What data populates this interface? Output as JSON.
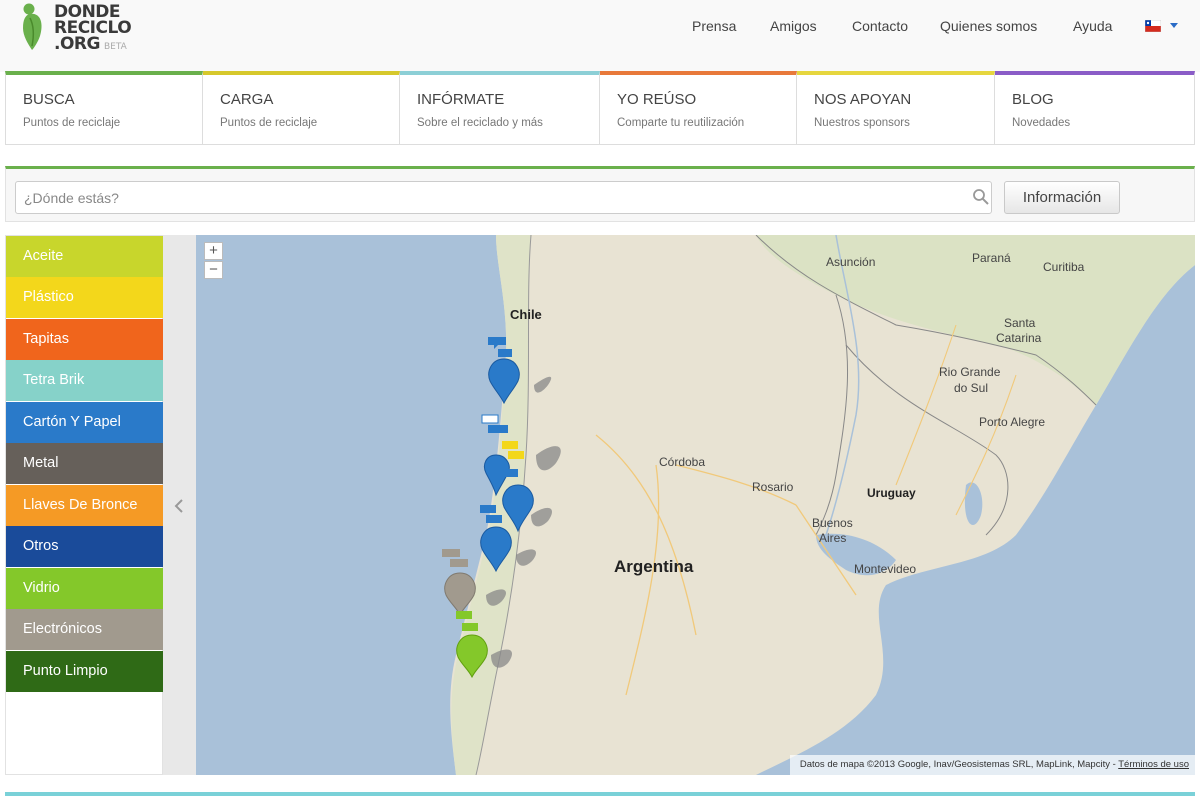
{
  "brand": {
    "logo_line1": "DONDE",
    "logo_line2": "RECICLO",
    "logo_line3": ".ORG",
    "beta": "BETA"
  },
  "topnav": [
    "Prensa",
    "Amigos",
    "Contacto",
    "Quienes somos",
    "Ayuda"
  ],
  "tabs": [
    {
      "title": "BUSCA",
      "subtitle": "Puntos de reciclaje",
      "color": "#6ab04c"
    },
    {
      "title": "CARGA",
      "subtitle": "Puntos de reciclaje",
      "color": "#d6c82c"
    },
    {
      "title": "INFÓRMATE",
      "subtitle": "Sobre el reciclado y más",
      "color": "#8ccfd6"
    },
    {
      "title": "YO REÚSO",
      "subtitle": "Comparte tu reutilización",
      "color": "#e8793a"
    },
    {
      "title": "NOS APOYAN",
      "subtitle": "Nuestros sponsors",
      "color": "#e6d63e"
    },
    {
      "title": "BLOG",
      "subtitle": "Novedades",
      "color": "#8a5cc7"
    }
  ],
  "search": {
    "placeholder": "¿Dónde estás?",
    "value": "",
    "info_button": "Información"
  },
  "categories": [
    {
      "label": "Aceite",
      "color": "#c8d62c"
    },
    {
      "label": "Plástico",
      "color": "#f3d71b"
    },
    {
      "label": "Tapitas",
      "color": "#f0651c"
    },
    {
      "label": "Tetra Brik",
      "color": "#86d2c9"
    },
    {
      "label": "Cartón Y Papel",
      "color": "#2a7ac9"
    },
    {
      "label": "Metal",
      "color": "#66605a"
    },
    {
      "label": "Llaves De Bronce",
      "color": "#f59a25"
    },
    {
      "label": "Otros",
      "color": "#1a4b9a"
    },
    {
      "label": "Vidrio",
      "color": "#84c82a"
    },
    {
      "label": "Electrónicos",
      "color": "#a19a8e"
    },
    {
      "label": "Punto Limpio",
      "color": "#2f6a16"
    }
  ],
  "map": {
    "zoom_in": "+",
    "zoom_out": "−",
    "labels": {
      "asuncion": "Asunción",
      "parana": "Paraná",
      "curitiba": "Curitiba",
      "chile": "Chile",
      "santa_catarina_1": "Santa",
      "santa_catarina_2": "Catarina",
      "rio_grande_1": "Rio Grande",
      "rio_grande_2": "do Sul",
      "porto_alegre": "Porto Alegre",
      "cordoba": "Córdoba",
      "rosario": "Rosario",
      "uruguay": "Uruguay",
      "buenos_aires_1": "Buenos",
      "buenos_aires_2": "Aires",
      "montevideo": "Montevideo",
      "argentina": "Argentina"
    },
    "attribution": "Datos de mapa ©2013 Google, Inav/Geosistemas SRL, MapLink, Mapcity - ",
    "terms": "Términos de uso"
  }
}
